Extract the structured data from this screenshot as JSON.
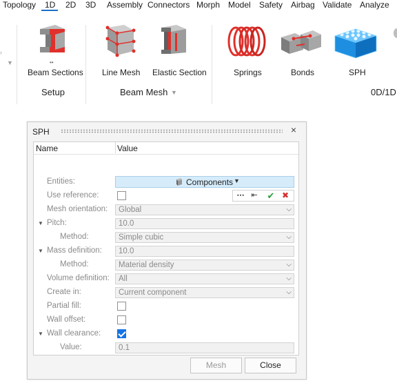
{
  "menubar": {
    "items": [
      "Topology",
      "1D",
      "2D",
      "3D",
      "Assembly",
      "Connectors",
      "Morph",
      "Model",
      "Safety",
      "Airbag",
      "Validate",
      "Analyze"
    ],
    "active": "1D"
  },
  "ribbon": {
    "tools": {
      "beam_sections": "Beam Sections",
      "line_mesh": "Line Mesh",
      "elastic_section": "Elastic Section",
      "springs": "Springs",
      "bonds": "Bonds",
      "sph": "SPH"
    },
    "groups": {
      "setup": "Setup",
      "beam_mesh": "Beam Mesh",
      "zero_d_one_d": "0D/1D"
    },
    "accent_color": "#e0302b",
    "sph_color": "#1e8fe0"
  },
  "dialog": {
    "title": "SPH",
    "columns": {
      "name": "Name",
      "value": "Value"
    },
    "rows": {
      "entities": {
        "label": "Entities:",
        "value": "Components"
      },
      "use_reference": {
        "label": "Use reference:"
      },
      "mesh_orientation": {
        "label": "Mesh orientation:",
        "value": "Global"
      },
      "pitch": {
        "label": "Pitch:",
        "value": "10.0"
      },
      "pitch_method": {
        "label": "Method:",
        "value": "Simple cubic"
      },
      "mass_definition": {
        "label": "Mass definition:",
        "value": "10.0"
      },
      "mass_method": {
        "label": "Method:",
        "value": "Material density"
      },
      "volume_definition": {
        "label": "Volume definition:",
        "value": "All"
      },
      "create_in": {
        "label": "Create in:",
        "value": "Current component"
      },
      "partial_fill": {
        "label": "Partial fill:"
      },
      "wall_offset": {
        "label": "Wall offset:"
      },
      "wall_clearance": {
        "label": "Wall clearance:"
      },
      "clearance_value": {
        "label": "Value:",
        "value": "0.1"
      }
    },
    "checkboxes": {
      "use_reference": false,
      "partial_fill": false,
      "wall_offset": false,
      "wall_clearance": true
    },
    "selector_toolbar": {
      "more": "⋯",
      "reset": "⇤",
      "accept": "✔",
      "cancel": "✖"
    },
    "buttons": {
      "mesh": "Mesh",
      "close": "Close"
    },
    "close_glyph": "×"
  }
}
